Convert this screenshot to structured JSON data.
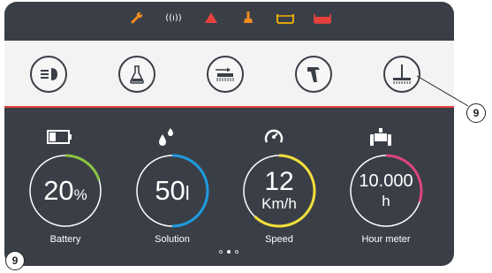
{
  "status_bar": {
    "icons": [
      {
        "name": "wrench-icon",
        "color": "#f28c1e"
      },
      {
        "name": "radio-signal-icon",
        "text": "((ı))",
        "color": "#ffffff"
      },
      {
        "name": "warning-triangle-icon",
        "color": "#e8413c"
      },
      {
        "name": "temperature-flask-icon",
        "color": "#f28c1e"
      },
      {
        "name": "tank-empty-icon",
        "color": "#f5b400"
      },
      {
        "name": "tank-full-icon",
        "color": "#e8413c"
      }
    ]
  },
  "function_buttons": [
    {
      "name": "headlight-button",
      "icon": "headlight-icon"
    },
    {
      "name": "detergent-button",
      "icon": "flask-icon"
    },
    {
      "name": "brush-button",
      "icon": "brush-icon"
    },
    {
      "name": "spray-gun-button",
      "icon": "spray-gun-icon"
    },
    {
      "name": "squeegee-button",
      "icon": "squeegee-icon"
    }
  ],
  "gauges": [
    {
      "name": "battery",
      "icon": "battery-icon",
      "value": "20",
      "unit": "%",
      "label": "Battery",
      "fraction": 0.2,
      "color": "#8cc63f"
    },
    {
      "name": "solution",
      "icon": "water-drops-icon",
      "value": "50",
      "unit": "l",
      "label": "Solution",
      "fraction": 0.5,
      "color": "#1e9be0"
    },
    {
      "name": "speed",
      "icon": "speedometer-icon",
      "value": "12",
      "unit": "Km/h",
      "label": "Speed",
      "fraction": 0.62,
      "color": "#f5e03a"
    },
    {
      "name": "hour-meter",
      "icon": "hour-meter-icon",
      "value": "10.000",
      "unit": "h",
      "label": "Hour meter",
      "fraction": 0.3,
      "color": "#e0457b"
    }
  ],
  "pager": {
    "pages": 3,
    "current": 2
  },
  "callouts": [
    "9",
    "9"
  ]
}
